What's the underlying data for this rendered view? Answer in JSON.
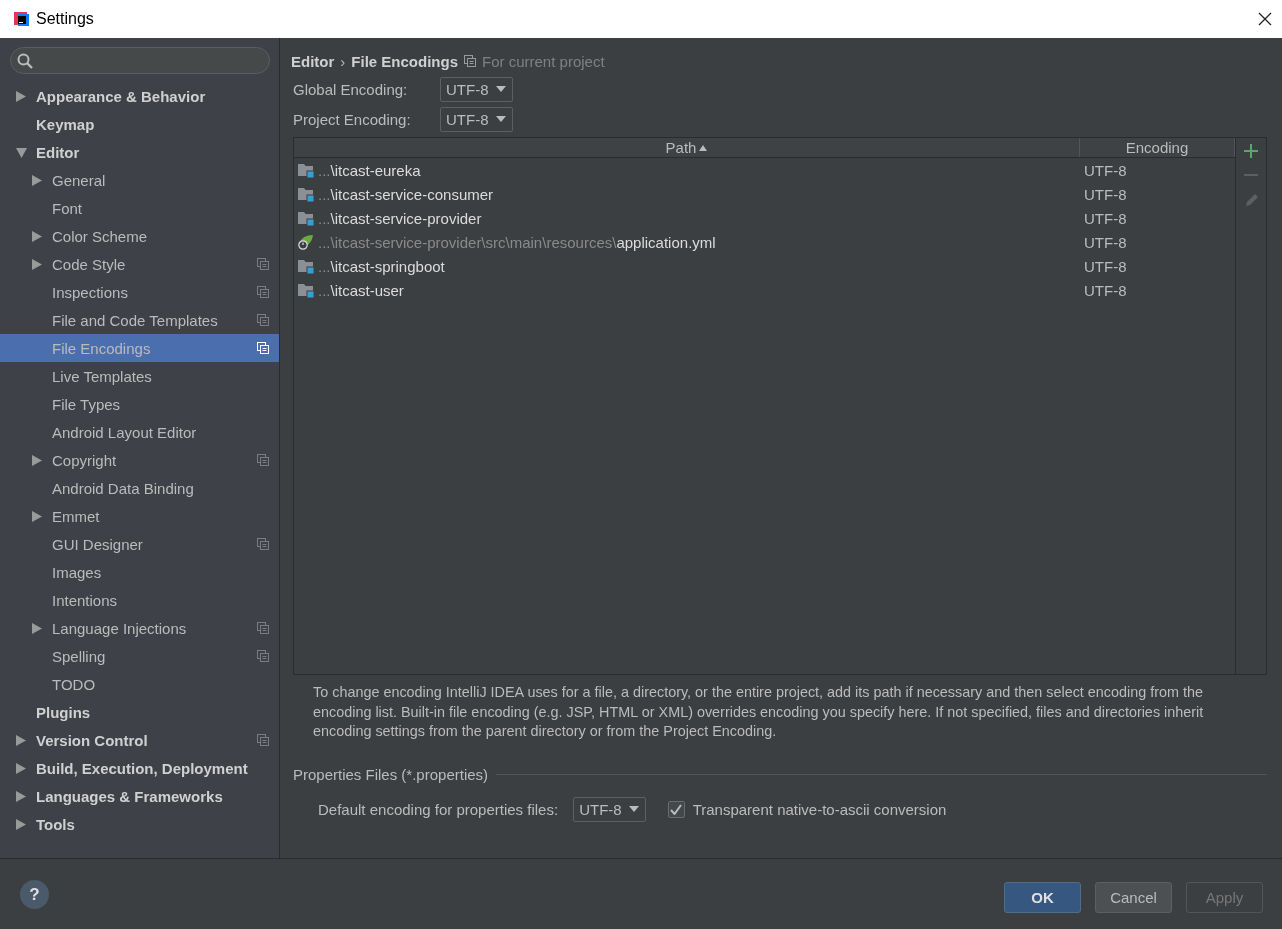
{
  "window": {
    "title": "Settings"
  },
  "sidebar": {
    "items": [
      {
        "label": "Appearance & Behavior",
        "expanded": false,
        "selected": false,
        "project_scoped": false
      },
      {
        "label": "Keymap",
        "selected": false,
        "project_scoped": false
      },
      {
        "label": "Editor",
        "expanded": true,
        "selected": false,
        "project_scoped": false,
        "children": [
          {
            "label": "General",
            "expanded": false,
            "selected": false,
            "project_scoped": false
          },
          {
            "label": "Font",
            "selected": false,
            "project_scoped": false
          },
          {
            "label": "Color Scheme",
            "expanded": false,
            "selected": false,
            "project_scoped": false
          },
          {
            "label": "Code Style",
            "expanded": false,
            "selected": false,
            "project_scoped": true
          },
          {
            "label": "Inspections",
            "selected": false,
            "project_scoped": true
          },
          {
            "label": "File and Code Templates",
            "selected": false,
            "project_scoped": true
          },
          {
            "label": "File Encodings",
            "selected": true,
            "project_scoped": true
          },
          {
            "label": "Live Templates",
            "selected": false,
            "project_scoped": false
          },
          {
            "label": "File Types",
            "selected": false,
            "project_scoped": false
          },
          {
            "label": "Android Layout Editor",
            "selected": false,
            "project_scoped": false
          },
          {
            "label": "Copyright",
            "expanded": false,
            "selected": false,
            "project_scoped": true
          },
          {
            "label": "Android Data Binding",
            "selected": false,
            "project_scoped": false
          },
          {
            "label": "Emmet",
            "expanded": false,
            "selected": false,
            "project_scoped": false
          },
          {
            "label": "GUI Designer",
            "selected": false,
            "project_scoped": true
          },
          {
            "label": "Images",
            "selected": false,
            "project_scoped": false
          },
          {
            "label": "Intentions",
            "selected": false,
            "project_scoped": false
          },
          {
            "label": "Language Injections",
            "expanded": false,
            "selected": false,
            "project_scoped": true
          },
          {
            "label": "Spelling",
            "selected": false,
            "project_scoped": true
          },
          {
            "label": "TODO",
            "selected": false,
            "project_scoped": false
          }
        ]
      },
      {
        "label": "Plugins",
        "selected": false,
        "project_scoped": false
      },
      {
        "label": "Version Control",
        "expanded": false,
        "selected": false,
        "project_scoped": true
      },
      {
        "label": "Build, Execution, Deployment",
        "expanded": false,
        "selected": false,
        "project_scoped": false
      },
      {
        "label": "Languages & Frameworks",
        "expanded": false,
        "selected": false,
        "project_scoped": false
      },
      {
        "label": "Tools",
        "expanded": false,
        "selected": false,
        "project_scoped": false
      }
    ]
  },
  "breadcrumb": {
    "path": [
      "Editor",
      "File Encodings"
    ],
    "separator": "›",
    "scope": "For current project"
  },
  "encodings": [
    {
      "label": "Global Encoding:",
      "value": "UTF-8"
    },
    {
      "label": "Project Encoding:",
      "value": "UTF-8"
    }
  ],
  "table": {
    "columns": [
      {
        "label": "Path",
        "sorted": true
      },
      {
        "label": "Encoding",
        "sorted": false
      }
    ],
    "rows": [
      {
        "kind": "module",
        "path_prefix": "...",
        "path_name": "\\itcast-eureka",
        "encoding": "UTF-8"
      },
      {
        "kind": "module",
        "path_prefix": "...",
        "path_name": "\\itcast-service-consumer",
        "encoding": "UTF-8"
      },
      {
        "kind": "module",
        "path_prefix": "...",
        "path_name": "\\itcast-service-provider",
        "encoding": "UTF-8"
      },
      {
        "kind": "spring-config",
        "path_prefix": "...\\itcast-service-provider\\src\\main\\resources\\",
        "path_name": "application.yml",
        "encoding": "UTF-8"
      },
      {
        "kind": "module",
        "path_prefix": "...",
        "path_name": "\\itcast-springboot",
        "encoding": "UTF-8"
      },
      {
        "kind": "module",
        "path_prefix": "...",
        "path_name": "\\itcast-user",
        "encoding": "UTF-8"
      }
    ],
    "toolbar": [
      {
        "kind": "add",
        "disabled": false
      },
      {
        "kind": "remove",
        "disabled": true
      },
      {
        "kind": "edit",
        "disabled": true
      }
    ]
  },
  "description": "To change encoding IntelliJ IDEA uses for a file, a directory, or the entire project, add its path if necessary and then select encoding from the encoding list. Built-in file encoding (e.g. JSP, HTML or XML) overrides encoding you specify here. If not specified, files and directories inherit encoding settings from the parent directory or from the Project Encoding.",
  "properties": {
    "title": "Properties Files (*.properties)",
    "default_label": "Default encoding for properties files:",
    "default_value": "UTF-8",
    "native_to_ascii": {
      "label": "Transparent native-to-ascii conversion",
      "checked": true
    }
  },
  "footer": {
    "help": "?",
    "buttons": [
      {
        "kind": "primary",
        "label": "OK",
        "disabled": false
      },
      {
        "kind": "normal",
        "label": "Cancel",
        "disabled": false
      },
      {
        "kind": "normal",
        "label": "Apply",
        "disabled": true
      }
    ]
  }
}
